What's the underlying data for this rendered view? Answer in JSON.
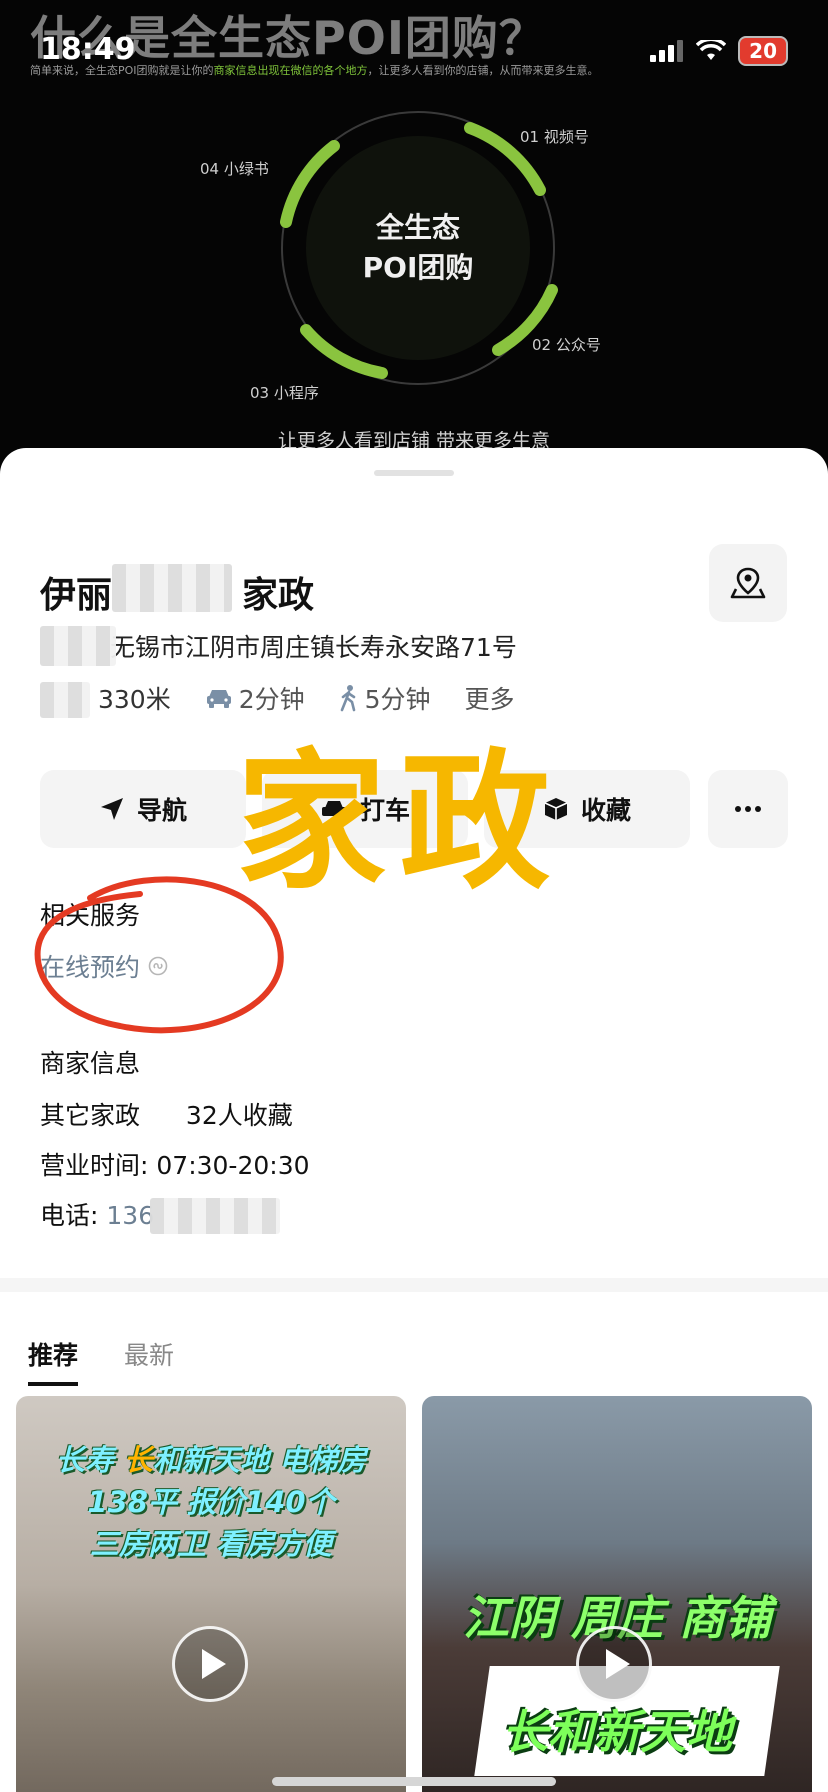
{
  "status_bar": {
    "time": "18:49",
    "battery": "20"
  },
  "banner": {
    "title": "什么是全生态POI团购？",
    "subtitle_pre": "简单来说，全生态POI团购就是让你的",
    "subtitle_hl": "商家信息出现在微信的各个地方",
    "subtitle_post": "，让更多人看到你的店铺，从而带来更多生意。",
    "center_line1": "全生态",
    "center_line2": "POI团购",
    "label_01": "01 视频号",
    "label_02": "02 公众号",
    "label_03": "03 小程序",
    "label_04": "04 小绿书",
    "bottom": "让更多人看到店铺 带来更多生意",
    "accent": "#8ac43f"
  },
  "shop": {
    "name_a": "伊丽",
    "name_b": "家政",
    "address": "无锡市江阴市周庄镇长寿永安路71号",
    "distance": "330米",
    "drive": "2分钟",
    "walk": "5分钟",
    "more": "更多"
  },
  "actions": {
    "navigate": "导航",
    "taxi": "打车",
    "favorite": "收藏"
  },
  "overlay": {
    "big_text": "家政",
    "color": "#f6b700"
  },
  "services": {
    "title": "相关服务",
    "online_booking": "在线预约"
  },
  "merchant": {
    "title": "商家信息",
    "category": "其它家政",
    "favorites": "32人收藏",
    "hours_label": "营业时间:",
    "hours": "07:30-20:30",
    "phone_label": "电话:",
    "phone": "136"
  },
  "tabs": [
    {
      "label": "推荐",
      "active": true
    },
    {
      "label": "最新",
      "active": false
    }
  ],
  "cards": [
    {
      "caption_l1a": "长寿 ",
      "caption_l1b": "长",
      "caption_l1c": "和新天地 电梯房",
      "caption_l2": "138平 报价140个",
      "caption_l3": "三房两卫 看房方便"
    },
    {
      "caption_l1": "江阴 周庄 商铺",
      "caption_l2": "长和新天地"
    }
  ]
}
